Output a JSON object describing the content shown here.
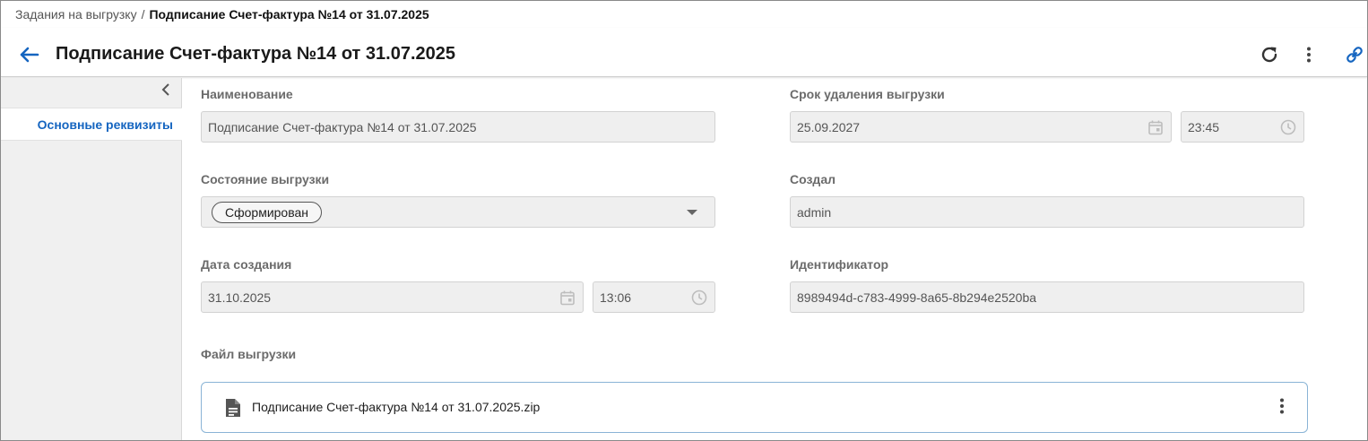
{
  "breadcrumb": {
    "parent": "Задания на выгрузку",
    "separator": "/",
    "current": "Подписание Счет-фактура №14 от 31.07.2025"
  },
  "header": {
    "title": "Подписание Счет-фактура №14 от 31.07.2025",
    "icons": [
      "arrow-left-icon",
      "refresh-icon",
      "more-vertical-icon",
      "link-icon"
    ]
  },
  "sidebar": {
    "items": [
      {
        "label": "Основные реквизиты",
        "active": true
      }
    ]
  },
  "form": {
    "name": {
      "label": "Наименование",
      "value": "Подписание Счет-фактура №14 от 31.07.2025"
    },
    "status": {
      "label": "Состояние выгрузки",
      "value": "Сформирован"
    },
    "created_date": {
      "label": "Дата создания",
      "date": "31.10.2025",
      "time": "13:06"
    },
    "delete_deadline": {
      "label": "Срок удаления выгрузки",
      "date": "25.09.2027",
      "time": "23:45"
    },
    "created_by": {
      "label": "Создал",
      "value": "admin"
    },
    "identifier": {
      "label": "Идентификатор",
      "value": "8989494d-c783-4999-8a65-8b294e2520ba"
    },
    "file": {
      "label": "Файл выгрузки",
      "name": "Подписание Счет-фактура №14 от 31.07.2025.zip"
    }
  },
  "colors": {
    "accent": "#1565c0",
    "field_bg": "#efefef",
    "label": "#6b6b6b",
    "file_border": "#8ab4d6"
  }
}
